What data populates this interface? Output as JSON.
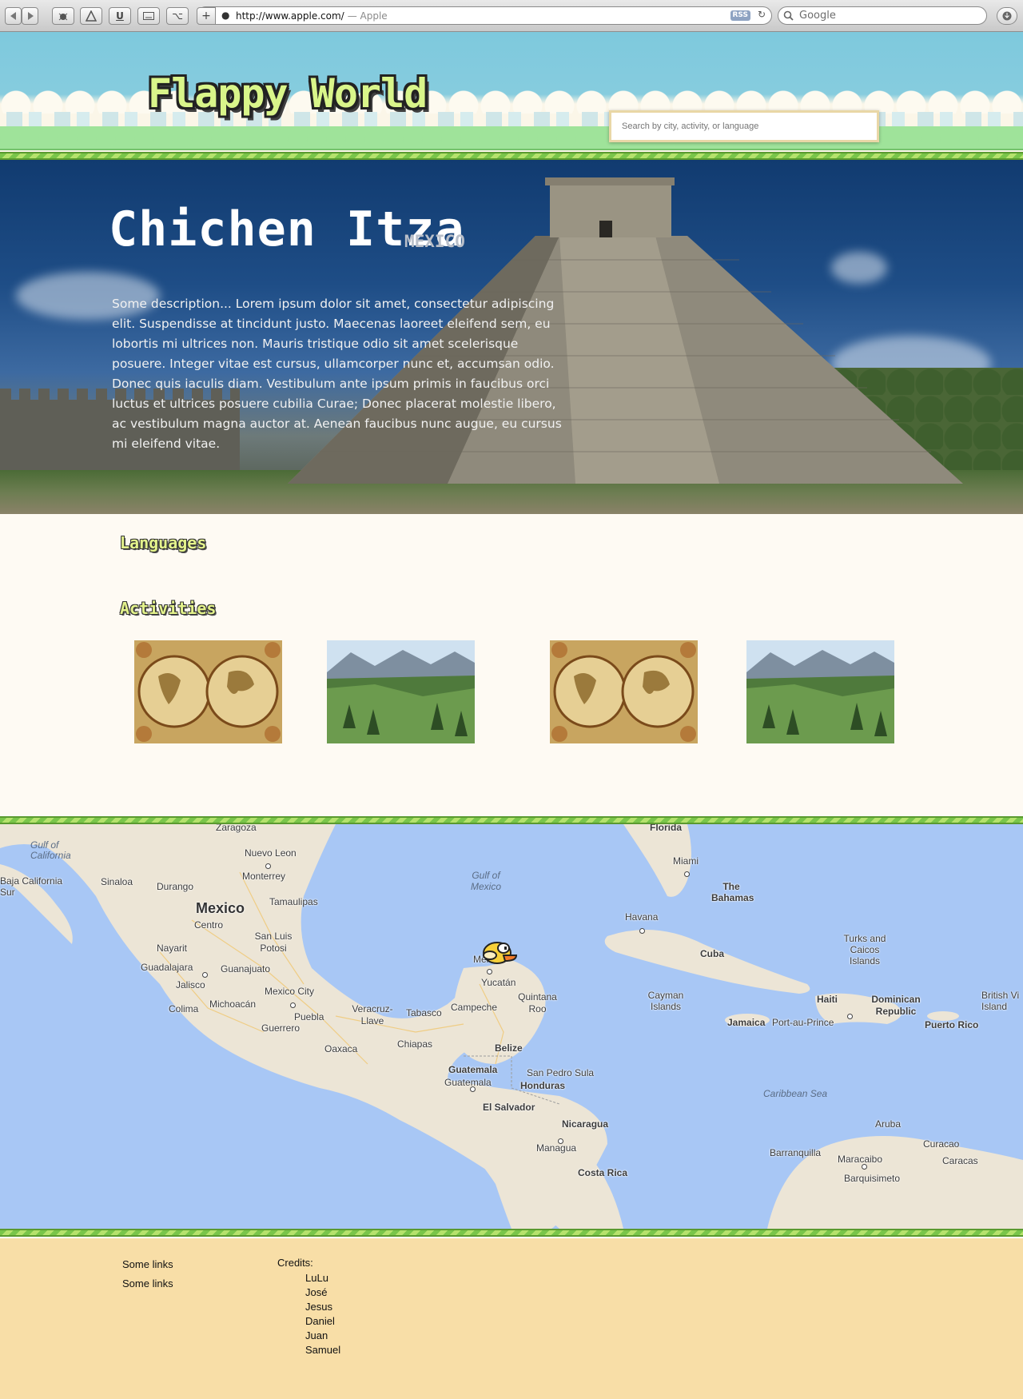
{
  "browser": {
    "url": "http://www.apple.com/",
    "page_title": "— Apple",
    "rss_label": "RSS",
    "search_placeholder": "Google"
  },
  "header": {
    "logo_text": "Flappy World",
    "search_placeholder": "Search by city, activity, or language"
  },
  "hero": {
    "title": "Chichen Itza",
    "country": "MEXICO",
    "description": "Some description... Lorem ipsum dolor sit amet, consectetur adipiscing elit. Suspendisse at tincidunt justo. Maecenas laoreet eleifend sem, eu lobortis mi ultrices non. Mauris tristique odio sit amet scelerisque posuere. Integer vitae est cursus, ullamcorper nunc et, accumsan odio. Donec quis iaculis diam. Vestibulum ante ipsum primis in faucibus orci luctus et ultrices posuere cubilia Curae; Donec placerat molestie libero, ac vestibulum magna auctor at. Aenean faucibus nunc augue, eu cursus mi eleifend vitae."
  },
  "sections": {
    "languages_heading": "Languages",
    "activities_heading": "Activities"
  },
  "activities": [
    {
      "image": "antique-world-map"
    },
    {
      "image": "mountain-valley"
    },
    {
      "image": "antique-world-map"
    },
    {
      "image": "mountain-valley"
    }
  ],
  "map": {
    "labels": [
      "Zaragoza",
      "Florida",
      "Gulf of California",
      "Nuevo Leon",
      "Miami",
      "Baja California Sur",
      "Sinaloa",
      "Durango",
      "Monterrey",
      "Gulf of Mexico",
      "The Bahamas",
      "Mexico",
      "Tamaulipas",
      "Centro",
      "Havana",
      "San Luis Potosi",
      "Nayarit",
      "Turks and Caicos Islands",
      "Merida",
      "Cuba",
      "Guadalajara",
      "Guanajuato",
      "Yucatán",
      "Jalisco",
      "Quintana Roo",
      "Michoacán",
      "Mexico City",
      "Cayman Islands",
      "British Vi Island",
      "Colima",
      "Veracruz-Llave",
      "Campeche",
      "Haiti",
      "Dominican Republic",
      "Puebla",
      "Tabasco",
      "Jamaica",
      "Port-au-Prince",
      "Puerto Rico",
      "Guerrero",
      "Chiapas",
      "Oaxaca",
      "Belize",
      "San Pedro Sula",
      "Guatemala",
      "Guatemala",
      "Honduras",
      "Caribbean Sea",
      "El Salvador",
      "Aruba",
      "Nicaragua",
      "Curacao",
      "Managua",
      "Barranquilla",
      "Maracaibo",
      "Caracas",
      "Costa Rica",
      "Barquisimeto"
    ]
  },
  "footer": {
    "links": [
      "Some links",
      "Some links"
    ],
    "credits_title": "Credits:",
    "credits": [
      "LuLu",
      "José",
      "Jesus",
      "Daniel",
      "Juan",
      "Samuel"
    ]
  },
  "colors": {
    "sky": "#7ec9dd",
    "grass_stripe": "#79c54a",
    "hero_blue": "#113b70",
    "content_bg": "#fefaf3",
    "map_water": "#a8c7f5",
    "footer_bg": "#f8dea7",
    "logo_fill": "#d9f58a"
  }
}
